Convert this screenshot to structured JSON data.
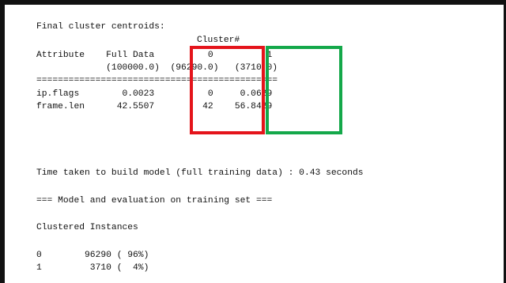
{
  "output": {
    "line1": "Final cluster centroids:",
    "line2": "Cluster#",
    "line3": "Attribute    Full Data          0          1",
    "line4": "             (100000.0)  (96290.0)   (3710.0)",
    "line5": "=============================================",
    "line6": "ip.flags        0.0023          0     0.0629",
    "line7": "frame.len      42.5507         42    56.8429",
    "line8": "Time taken to build model (full training data) : 0.43 seconds",
    "line9": "=== Model and evaluation on training set ===",
    "line10": "Clustered Instances",
    "line11": "0        96290 ( 96%)",
    "line12": "1         3710 (  4%)"
  },
  "highlight_colors": {
    "cluster0": "#e4141b",
    "cluster1": "#14a84a"
  }
}
